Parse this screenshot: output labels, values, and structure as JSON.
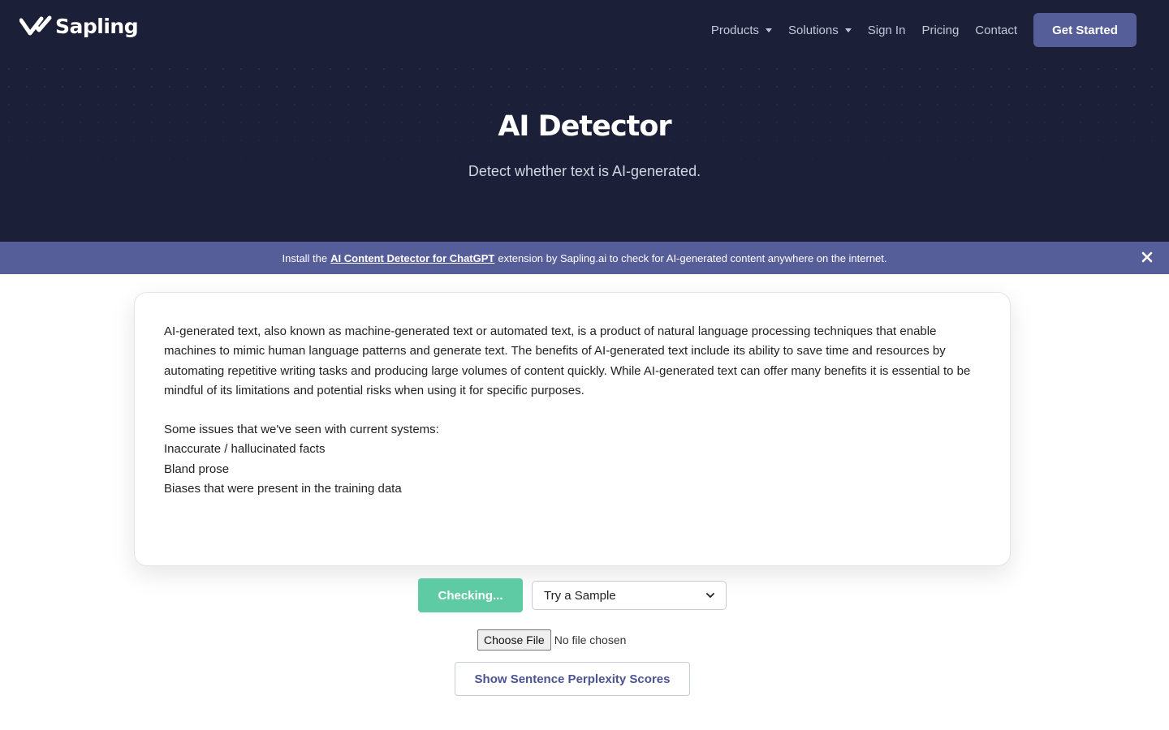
{
  "nav": {
    "brand": "Sapling",
    "items": [
      {
        "label": "Products",
        "dropdown": true
      },
      {
        "label": "Solutions",
        "dropdown": true
      },
      {
        "label": "Sign In",
        "dropdown": false
      },
      {
        "label": "Pricing",
        "dropdown": false
      },
      {
        "label": "Contact",
        "dropdown": false
      }
    ],
    "cta_label": "Get Started"
  },
  "hero": {
    "title": "AI Detector",
    "subtitle": "Detect whether text is AI-generated."
  },
  "banner": {
    "prefix": "Install the",
    "link_text": "AI Content Detector for ChatGPT",
    "suffix": "extension by Sapling.ai to check for AI-generated content anywhere on the internet."
  },
  "editor": {
    "paragraph": "AI-generated text, also known as machine-generated text or automated text, is a product of natural language processing techniques that enable machines to mimic human language patterns and generate text. The benefits of AI-generated text include its ability to save time and resources by automating repetitive writing tasks and producing large volumes of content quickly. While AI-generated text can offer many benefits it is essential to be mindful of its limitations and potential risks when using it for specific purposes.",
    "lines": [
      "Some issues that we've seen with current systems:",
      "Inaccurate / hallucinated facts",
      "Bland prose",
      "Biases that were present in the training data"
    ]
  },
  "controls": {
    "check_label": "Checking...",
    "sample_selected": "Try a Sample",
    "choose_file_label": "Choose File",
    "file_status": "No file chosen",
    "perplexity_label": "Show Sentence Perplexity Scores"
  },
  "colors": {
    "nav_bg": "#1c1f38",
    "accent": "#565e99",
    "check_green": "#5ecba5"
  }
}
